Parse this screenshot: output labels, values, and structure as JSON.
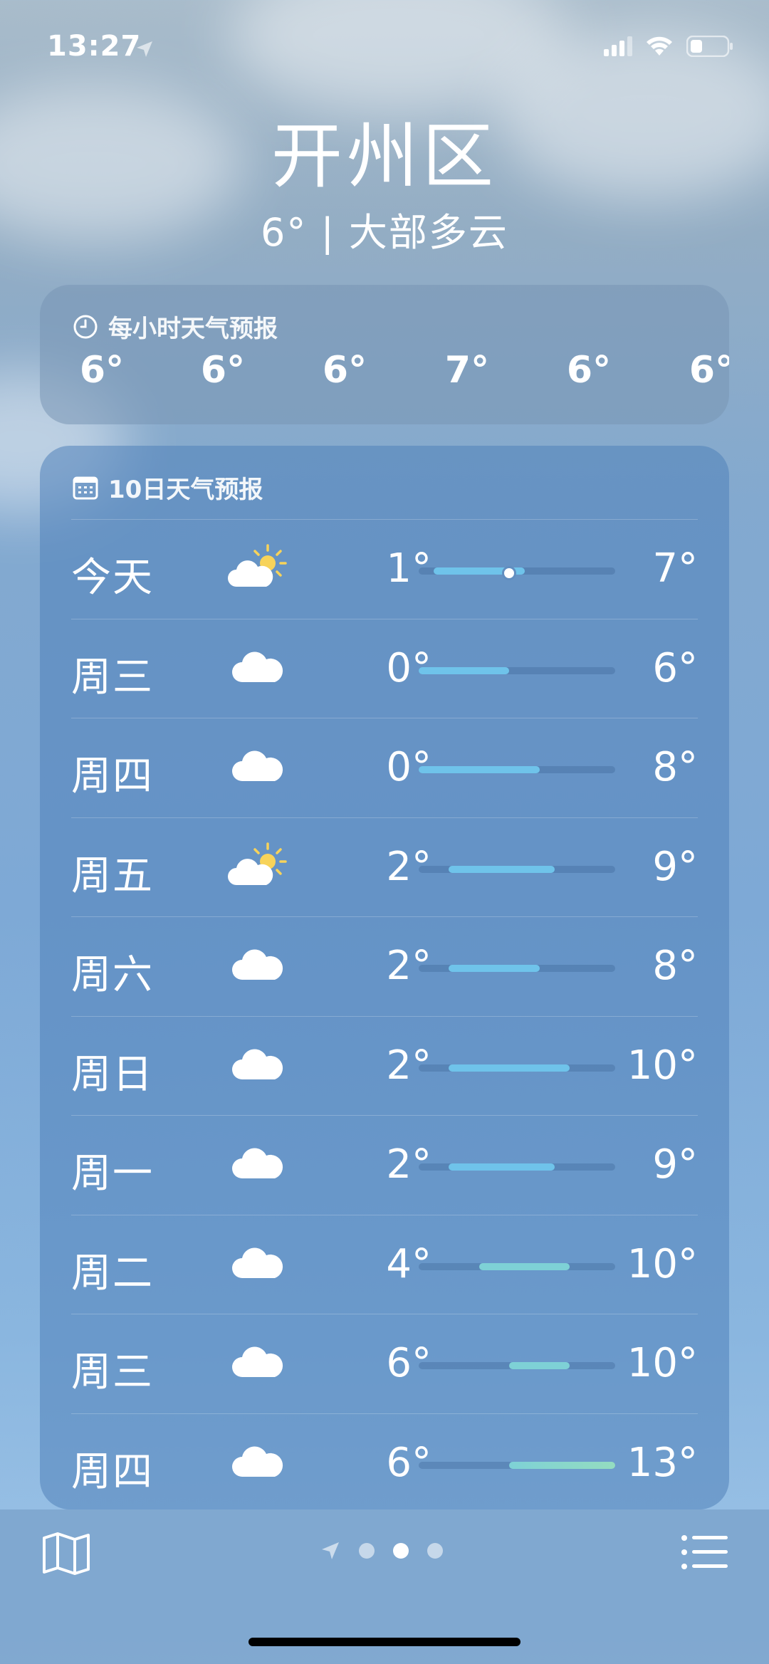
{
  "status_bar": {
    "time": "13:27"
  },
  "location": {
    "city": "开州区",
    "summary": "6° | 大部多云"
  },
  "hourly": {
    "title": "每小时天气预报",
    "temps": [
      "6°",
      "6°",
      "6°",
      "7°",
      "6°",
      "6°"
    ]
  },
  "daily": {
    "title": "10日天气预报",
    "days": [
      {
        "day": "今天",
        "icon": "partly-sunny-icon",
        "low": "1°",
        "high": "7°",
        "range_low": 1,
        "range_high": 7,
        "current": 6
      },
      {
        "day": "周三",
        "icon": "cloud-icon",
        "low": "0°",
        "high": "6°",
        "range_low": 0,
        "range_high": 6
      },
      {
        "day": "周四",
        "icon": "cloud-icon",
        "low": "0°",
        "high": "8°",
        "range_low": 0,
        "range_high": 8
      },
      {
        "day": "周五",
        "icon": "partly-sunny-icon",
        "low": "2°",
        "high": "9°",
        "range_low": 2,
        "range_high": 9
      },
      {
        "day": "周六",
        "icon": "cloud-icon",
        "low": "2°",
        "high": "8°",
        "range_low": 2,
        "range_high": 8
      },
      {
        "day": "周日",
        "icon": "cloud-icon",
        "low": "2°",
        "high": "10°",
        "range_low": 2,
        "range_high": 10
      },
      {
        "day": "周一",
        "icon": "cloud-icon",
        "low": "2°",
        "high": "9°",
        "range_low": 2,
        "range_high": 9
      },
      {
        "day": "周二",
        "icon": "cloud-icon",
        "low": "4°",
        "high": "10°",
        "range_low": 4,
        "range_high": 10
      },
      {
        "day": "周三",
        "icon": "cloud-icon",
        "low": "6°",
        "high": "10°",
        "range_low": 6,
        "range_high": 10
      },
      {
        "day": "周四",
        "icon": "cloud-icon",
        "low": "6°",
        "high": "13°",
        "range_low": 6,
        "range_high": 13
      }
    ]
  },
  "pager": {
    "pages": 3,
    "active": 1
  },
  "colors": {
    "cool": "#6fc3ea",
    "mild": "#7ed1d6",
    "warm": "#94dcc0"
  }
}
